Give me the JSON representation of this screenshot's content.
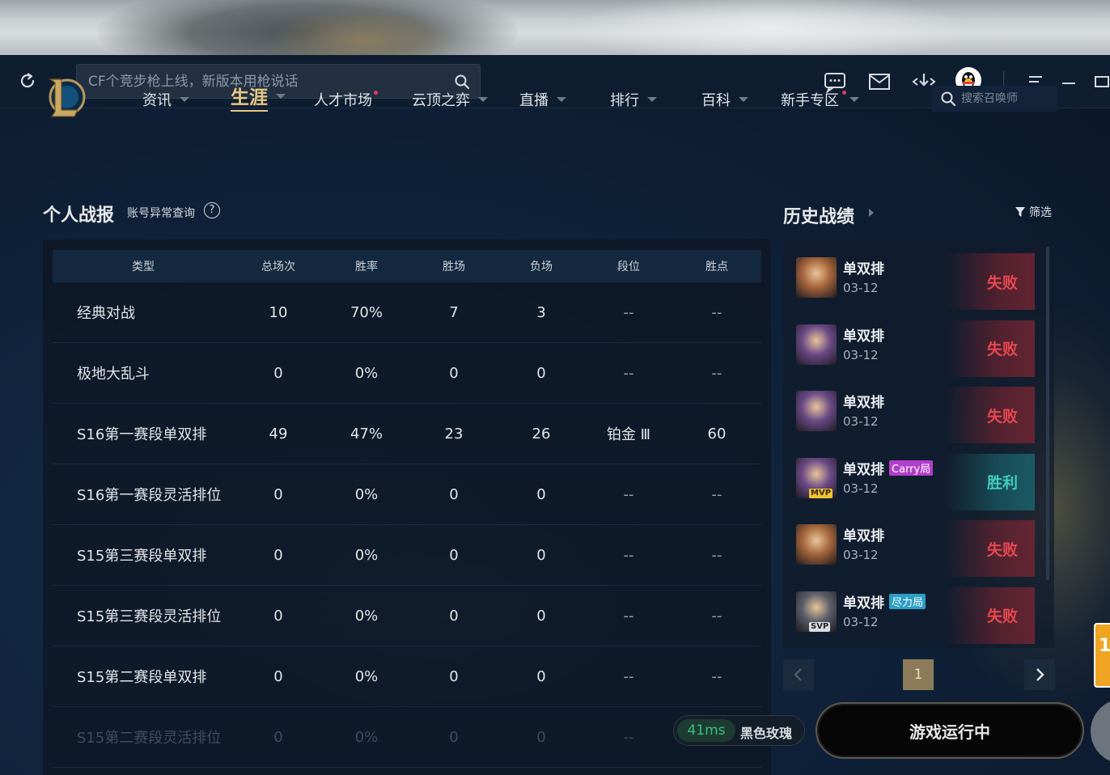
{
  "titlebar": {
    "search_placeholder": "CF个竞步枪上线，新版本用枪说话",
    "icons": [
      "refresh-icon",
      "chat-icon",
      "mail-icon",
      "download-icon",
      "qq-avatar-icon",
      "menu-icon",
      "minimize-icon",
      "maximize-icon"
    ]
  },
  "nav": {
    "items": [
      {
        "label": "资讯",
        "caret": true
      },
      {
        "label": "生涯",
        "caret": true,
        "active": true
      },
      {
        "label": "人才市场",
        "dot": true
      },
      {
        "label": "云顶之弈",
        "caret": true
      },
      {
        "label": "直播",
        "caret": true
      },
      {
        "label": "排行",
        "caret": true
      },
      {
        "label": "百科",
        "caret": true
      },
      {
        "label": "新手专区",
        "caret": true,
        "dot": true
      }
    ],
    "summoner_search_placeholder": "搜索召唤师"
  },
  "stats": {
    "title": "个人战报",
    "link": "账号异常查询",
    "help": "?",
    "columns": [
      "类型",
      "总场次",
      "胜率",
      "胜场",
      "负场",
      "段位",
      "胜点"
    ],
    "rows": [
      [
        "经典对战",
        "10",
        "70%",
        "7",
        "3",
        "--",
        "--"
      ],
      [
        "极地大乱斗",
        "0",
        "0%",
        "0",
        "0",
        "--",
        "--"
      ],
      [
        "S16第一赛段单双排",
        "49",
        "47%",
        "23",
        "26",
        "铂金 Ⅲ",
        "60"
      ],
      [
        "S16第一赛段灵活排位",
        "0",
        "0%",
        "0",
        "0",
        "--",
        "--"
      ],
      [
        "S15第三赛段单双排",
        "0",
        "0%",
        "0",
        "0",
        "--",
        "--"
      ],
      [
        "S15第三赛段灵活排位",
        "0",
        "0%",
        "0",
        "0",
        "--",
        "--"
      ],
      [
        "S15第二赛段单双排",
        "0",
        "0%",
        "0",
        "0",
        "--",
        "--"
      ],
      [
        "S15第二赛段灵活排位",
        "0",
        "0%",
        "0",
        "0",
        "--",
        "--"
      ]
    ]
  },
  "history": {
    "title": "历史战绩",
    "filter_label": "筛选",
    "items": [
      {
        "mode": "单双排",
        "date": "03-12",
        "result": "失败",
        "win": false,
        "tag": "",
        "badge": "",
        "champ_color": "#a4643a"
      },
      {
        "mode": "单双排",
        "date": "03-12",
        "result": "失败",
        "win": false,
        "tag": "",
        "badge": "",
        "champ_color": "#6b4a86"
      },
      {
        "mode": "单双排",
        "date": "03-12",
        "result": "失败",
        "win": false,
        "tag": "",
        "badge": "",
        "champ_color": "#6b4a86"
      },
      {
        "mode": "单双排",
        "date": "03-12",
        "result": "胜利",
        "win": true,
        "tag": "Carry局",
        "badge": "MVP",
        "champ_color": "#6b4a86"
      },
      {
        "mode": "单双排",
        "date": "03-12",
        "result": "失败",
        "win": false,
        "tag": "",
        "badge": "",
        "champ_color": "#a4643a"
      },
      {
        "mode": "单双排",
        "date": "03-12",
        "result": "失败",
        "win": false,
        "tag": "尽力局",
        "badge": "SVP",
        "champ_color": "#5a5e68"
      }
    ],
    "page": "1"
  },
  "status": {
    "ping": "41ms",
    "server": "黑色玫瑰",
    "game_button": "游戏运行中"
  },
  "side_ad": {
    "text": "1"
  }
}
